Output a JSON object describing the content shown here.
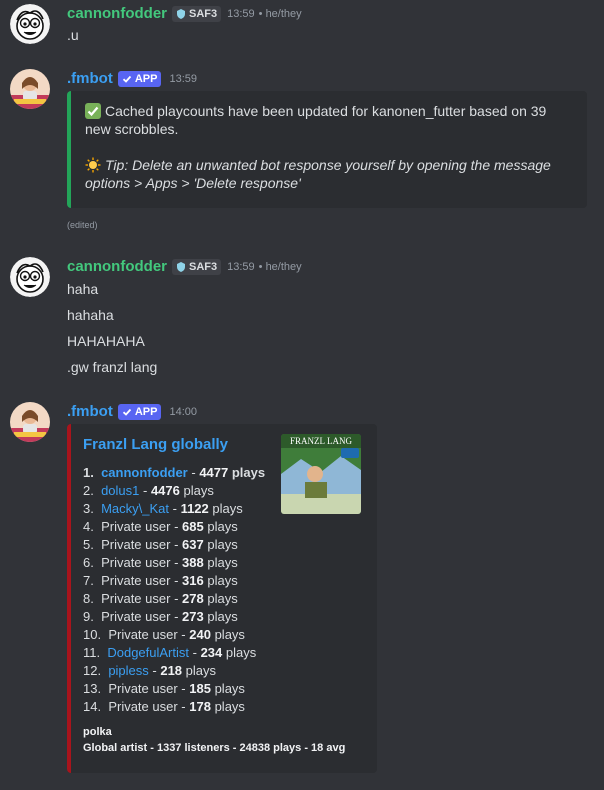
{
  "messages": {
    "m1": {
      "username": "cannonfodder",
      "guild_tag": "SAF3",
      "time": "13:59",
      "pronouns": "• he/they",
      "lines": [
        ".u"
      ]
    },
    "m2": {
      "username": ".fmbot",
      "app_tag": "APP",
      "time": "13:59",
      "embed": {
        "text": "Cached playcounts have been updated for kanonen_futter based on 39 new scrobbles.",
        "tip": "Tip: Delete an unwanted bot response yourself by opening the message options > Apps > 'Delete response'"
      },
      "edited": "(edited)"
    },
    "m3": {
      "username": "cannonfodder",
      "guild_tag": "SAF3",
      "time": "13:59",
      "pronouns": "• he/they",
      "lines": [
        "haha",
        "hahaha",
        "HAHAHAHA",
        ".gw franzl lang"
      ]
    },
    "m4": {
      "username": ".fmbot",
      "app_tag": "APP",
      "time": "14:00",
      "embed": {
        "title": "Franzl Lang globally",
        "thumb_text": "FRANZL LANG",
        "rows": [
          {
            "num": "1.",
            "name": "cannonfodder",
            "link": true,
            "plays": "4477",
            "unit": "plays"
          },
          {
            "num": "2.",
            "name": "dolus1",
            "link": true,
            "plays": "4476",
            "unit": "plays"
          },
          {
            "num": "3.",
            "name": "Macky\\_Kat",
            "link": true,
            "plays": "1122",
            "unit": "plays"
          },
          {
            "num": "4.",
            "name": "Private user",
            "link": false,
            "plays": "685",
            "unit": "plays"
          },
          {
            "num": "5.",
            "name": "Private user",
            "link": false,
            "plays": "637",
            "unit": "plays"
          },
          {
            "num": "6.",
            "name": "Private user",
            "link": false,
            "plays": "388",
            "unit": "plays"
          },
          {
            "num": "7.",
            "name": "Private user",
            "link": false,
            "plays": "316",
            "unit": "plays"
          },
          {
            "num": "8.",
            "name": "Private user",
            "link": false,
            "plays": "278",
            "unit": "plays"
          },
          {
            "num": "9.",
            "name": "Private user",
            "link": false,
            "plays": "273",
            "unit": "plays"
          },
          {
            "num": "10.",
            "name": "Private user",
            "link": false,
            "plays": "240",
            "unit": "plays"
          },
          {
            "num": "11.",
            "name": "DodgefulArtist",
            "link": true,
            "plays": "234",
            "unit": "plays"
          },
          {
            "num": "12.",
            "name": "pipless",
            "link": true,
            "plays": "218",
            "unit": "plays"
          },
          {
            "num": "13.",
            "name": "Private user",
            "link": false,
            "plays": "185",
            "unit": "plays"
          },
          {
            "num": "14.",
            "name": "Private user",
            "link": false,
            "plays": "178",
            "unit": "plays"
          }
        ],
        "footer_genre": "polka",
        "footer_stats": "Global artist - 1337 listeners - 24838 plays - 18 avg"
      }
    }
  },
  "colors": {
    "background": "#313338",
    "embed_bg": "#2b2d31",
    "user_name": "#43c87d",
    "bot_name": "#3b9ff2",
    "success_bar": "#23a559",
    "artist_bar": "#a8141c"
  }
}
